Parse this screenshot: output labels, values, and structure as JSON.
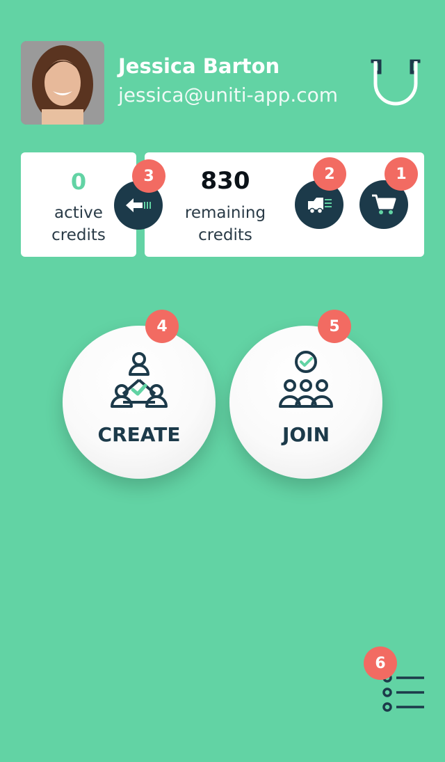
{
  "profile": {
    "name": "Jessica Barton",
    "email": "jessica@uniti-app.com"
  },
  "credits": {
    "active_value": "0",
    "active_label_1": "active",
    "active_label_2": "credits",
    "remaining_value": "830",
    "remaining_label_1": "remaining",
    "remaining_label_2": "credits"
  },
  "badges": {
    "cart": "1",
    "delivery": "2",
    "transfer": "3",
    "create": "4",
    "join": "5",
    "menu": "6"
  },
  "actions": {
    "create_label": "CREATE",
    "join_label": "JOIN"
  },
  "colors": {
    "background": "#62D3A4",
    "dark": "#1C3A4A",
    "badge": "#F26B62",
    "card": "#FFFFFF"
  }
}
